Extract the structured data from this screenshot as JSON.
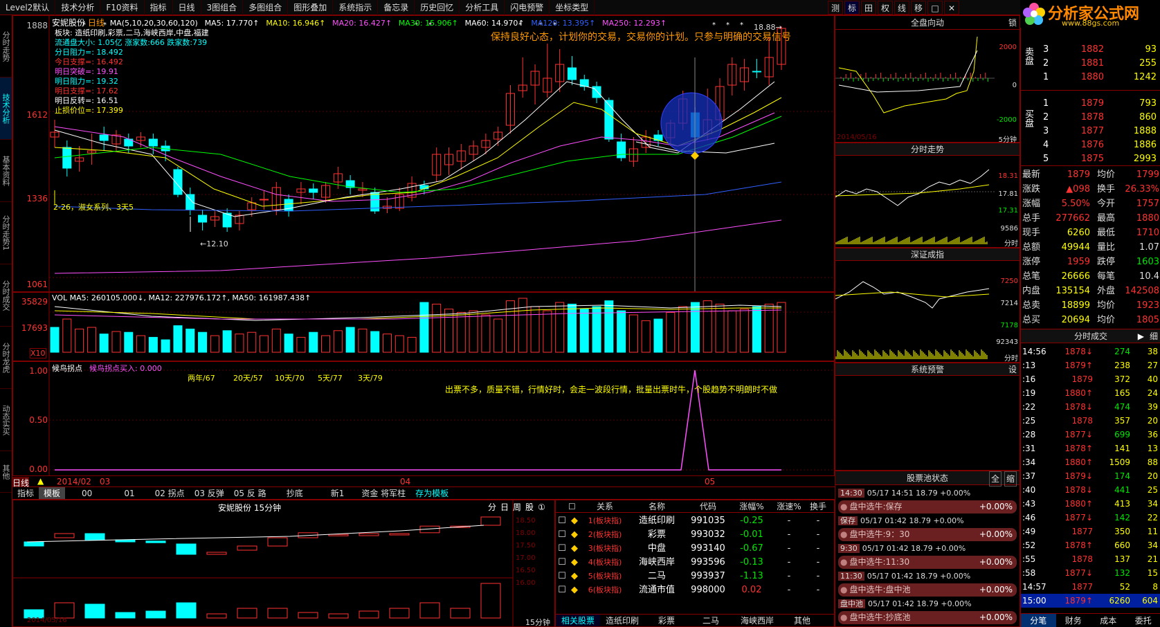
{
  "menu": {
    "items": [
      "Level2默认",
      "技术分析",
      "F10资料",
      "指标",
      "日线",
      "3图组合",
      "多图组合",
      "图形叠加",
      "系统指示",
      "备忘录",
      "历史回忆",
      "分析工具",
      "闪电预警",
      "坐标类型"
    ],
    "right": [
      "测",
      "标",
      "田",
      "权",
      "线",
      "移",
      "□",
      "✕"
    ]
  },
  "brand": {
    "logo": "分析家公式网",
    "url": "www.88gs.com"
  },
  "left_tabs": [
    "分时走势",
    "技术分析",
    "基本资料",
    "分时走势1",
    "分时成交",
    "分时龙虎",
    "动态实买",
    "其他"
  ],
  "main": {
    "stock": "安妮股份",
    "period": "日线",
    "ma_params": "MA(5,10,20,30,60,120)",
    "ma": [
      {
        "label": "MA5: 17.770↑",
        "color": "#ffffff"
      },
      {
        "label": "MA10: 16.946↑",
        "color": "#ffff00"
      },
      {
        "label": "MA20: 16.427↑",
        "color": "#ff50ff"
      },
      {
        "label": "MA30: 15.906↑",
        "color": "#00ff00"
      },
      {
        "label": "MA60: 14.970↑",
        "color": "#ffffff"
      },
      {
        "label": "MA120: 13.395↑",
        "color": "#3060ff"
      },
      {
        "label": "MA250: 12.293↑",
        "color": "#ff50ff"
      }
    ],
    "info": [
      {
        "text": "板块: 造纸印刷,彩票,二马,海峡西岸,中盘,福建",
        "color": "#ffffff"
      },
      {
        "text": "流通盘大小: 1.05亿  涨家数:666   跌家数:739",
        "color": "#00ffff"
      },
      {
        "text": "分日阻力=: 18.492",
        "color": "#00ffff"
      },
      {
        "text": "今日支撑=: 16.492",
        "color": "#ff3232"
      },
      {
        "text": "明日突破=: 19.91",
        "color": "#ff50ff"
      },
      {
        "text": "明日阻力=: 19.32",
        "color": "#00ffff"
      },
      {
        "text": "明日支撑=: 17.62",
        "color": "#ff3232"
      },
      {
        "text": "明日反转=: 16.51",
        "color": "#ffffff"
      },
      {
        "text": "止损价位=: 17.399",
        "color": "#ffff00"
      }
    ],
    "slogan": "保持良好心态，计划你的交易，交易你的计划。只参与明确的交易信号",
    "annotation": "2-26，淑女系列、3天5",
    "low_label": "12.10",
    "high_label": "18.88",
    "yaxis": [
      "1888",
      "1612",
      "1336",
      "1061"
    ]
  },
  "vol": {
    "header": "VOL MA5: 260105.000↓, MA12: 227976.172↑, MA50: 161987.438↑",
    "yaxis": [
      "35829",
      "17693"
    ],
    "x10": "X10"
  },
  "ind": {
    "title": "候鸟拐点",
    "title2": "候鸟拐点买入: 0.000",
    "stats": [
      "两年/67",
      "20天/57",
      "10天/70",
      "5天/77",
      "3天/79"
    ],
    "msg": "出票不多，质量不错，行情好时，会走一波段行情，批量出票时牛，个股趋势不明朗时不做",
    "yaxis": [
      "1.00",
      "0.50",
      "0.00"
    ],
    "xlabels": [
      "2014/02",
      "03",
      "04",
      "05"
    ]
  },
  "bottom_tabs": {
    "period": "日线",
    "items": [
      "指标",
      "模板",
      "00",
      "01",
      "02 拐点",
      "03 反弹",
      "05 反 路",
      "抄底",
      "新1",
      "资金 将军柱",
      "存为模板"
    ]
  },
  "sub": {
    "title": "安妮股份 15分钟",
    "btns": [
      "分",
      "日",
      "周",
      "股",
      "①"
    ],
    "yaxis": [
      "18.50",
      "18.00",
      "17.50",
      "17.00",
      "16.50",
      "16.00"
    ],
    "date": "2014/05/16",
    "period": "15分钟"
  },
  "rel": {
    "headers": [
      "关系",
      "名称",
      "代码",
      "涨幅%",
      "涨速%",
      "换手"
    ],
    "rows": [
      {
        "rel": "1(板块指)",
        "name": "造纸印刷",
        "code": "991035",
        "chg": "-0.25",
        "spd": "-",
        "tv": "-"
      },
      {
        "rel": "2(板块指)",
        "name": "彩票",
        "code": "993032",
        "chg": "-0.01",
        "spd": "-",
        "tv": "-"
      },
      {
        "rel": "3(板块指)",
        "name": "中盘",
        "code": "993140",
        "chg": "-0.67",
        "spd": "-",
        "tv": "-"
      },
      {
        "rel": "4(板块指)",
        "name": "海峡西岸",
        "code": "993596",
        "chg": "-0.13",
        "spd": "-",
        "tv": "-"
      },
      {
        "rel": "5(板块指)",
        "name": "二马",
        "code": "993937",
        "chg": "-1.13",
        "spd": "-",
        "tv": "-"
      },
      {
        "rel": "6(板块指)",
        "name": "流通市值",
        "code": "998000",
        "chg": "0.02",
        "spd": "-",
        "tv": "-"
      }
    ],
    "tabs": [
      "相关股票",
      "造纸印刷",
      "彩票",
      "二马",
      "海峡西岸",
      "其他"
    ]
  },
  "mid": {
    "t1": "全盘向动",
    "t1b": "锁",
    "t1y": [
      "2000",
      "0",
      "-2000"
    ],
    "t1date": "2014/05/16",
    "t1p": "5分钟",
    "t2": "分时走势",
    "t2y": [
      "18.31",
      "17.81",
      "17.31",
      "9586"
    ],
    "t2p": "分时",
    "t3": "深证成指",
    "t3y": [
      "7250",
      "7214",
      "7178",
      "92343"
    ],
    "t3p": "分时",
    "t4": "系统预警",
    "t4b": "设"
  },
  "pool": {
    "title": "股票池状态",
    "btns": [
      "全",
      "缩"
    ],
    "items": [
      {
        "tag": "14:30",
        "text": "05/17 14:51 18.79 +0.00%",
        "bar": "盘中选牛:保存",
        "pct": "+0.00%"
      },
      {
        "tag": "保存",
        "text": "05/17 01:42 18.79 +0.00%",
        "bar": "盘中选牛:9：30",
        "pct": "+0.00%"
      },
      {
        "tag": "9:30",
        "text": "05/17 01:42 18.79 +0.00%",
        "bar": "盘中选牛:11:30",
        "pct": "+0.00%"
      },
      {
        "tag": "11:30",
        "text": "05/17 01:42 18.79 +0.00%",
        "bar": "盘中选牛:盘中池",
        "pct": "+0.00%"
      },
      {
        "tag": "盘中池",
        "text": "05/17 01:42 18.79 +0.00%",
        "bar": "盘中选牛:抄底池",
        "pct": "+0.00%"
      }
    ]
  },
  "quote": {
    "sell": [
      {
        "l": "3",
        "p": "1882",
        "v": "93"
      },
      {
        "l": "2",
        "p": "1881",
        "v": "255"
      },
      {
        "l": "1",
        "p": "1880",
        "v": "1242"
      }
    ],
    "sell_label": "卖盘",
    "buy_label": "买盘",
    "buy": [
      {
        "l": "1",
        "p": "1879",
        "v": "793"
      },
      {
        "l": "2",
        "p": "1878",
        "v": "860"
      },
      {
        "l": "3",
        "p": "1877",
        "v": "1888"
      },
      {
        "l": "4",
        "p": "1876",
        "v": "1886"
      },
      {
        "l": "5",
        "p": "1875",
        "v": "2993"
      }
    ],
    "stats": [
      [
        "最新",
        "1879",
        "均价",
        "1799"
      ],
      [
        "涨跌",
        "▲098",
        "换手",
        "26.33%"
      ],
      [
        "涨幅",
        "5.50%",
        "今开",
        "1757"
      ],
      [
        "总手",
        "277662",
        "最高",
        "1880"
      ],
      [
        "现手",
        "6260",
        "最低",
        "1710"
      ],
      [
        "总额",
        "49944",
        "量比",
        "1.07"
      ],
      [
        "涨停",
        "1959",
        "跌停",
        "1603"
      ],
      [
        "总笔",
        "26666",
        "每笔",
        "10.4"
      ],
      [
        "内盘",
        "135154",
        "外盘",
        "142508"
      ],
      [
        "总卖",
        "18899",
        "均价",
        "1923"
      ],
      [
        "总买",
        "20694",
        "均价",
        "1805"
      ]
    ],
    "ticks_title": "分时成交",
    "ticks_side": "细",
    "ticks": [
      [
        "14:56",
        "1878↓",
        "274",
        "38"
      ],
      [
        ":13",
        "1879↑",
        "238",
        "27"
      ],
      [
        ":16",
        "1879",
        "372",
        "40"
      ],
      [
        ":19",
        "1880↑",
        "165",
        "24"
      ],
      [
        ":22",
        "1878↓",
        "474",
        "39"
      ],
      [
        ":25",
        "1878",
        "357",
        "20"
      ],
      [
        ":28",
        "1877↓",
        "699",
        "36"
      ],
      [
        ":31",
        "1878↑",
        "141",
        "13"
      ],
      [
        ":34",
        "1880↑",
        "1509",
        "88"
      ],
      [
        ":37",
        "1879↓",
        "174",
        "20"
      ],
      [
        ":40",
        "1878↓",
        "441",
        "25"
      ],
      [
        ":43",
        "1880↑",
        "413",
        "34"
      ],
      [
        ":46",
        "1877↓",
        "142",
        "22"
      ],
      [
        ":49",
        "1877",
        "350",
        "11"
      ],
      [
        ":52",
        "1878↑",
        "660",
        "34"
      ],
      [
        ":55",
        "1878",
        "137",
        "21"
      ],
      [
        ":58",
        "1877↓",
        "132",
        "15"
      ],
      [
        "14:57",
        "1877",
        "52",
        "8"
      ],
      [
        "15:00",
        "1879↑",
        "6260",
        "604"
      ]
    ],
    "bottom_tabs": [
      "分笔",
      "财务",
      "成本",
      "委托"
    ]
  }
}
